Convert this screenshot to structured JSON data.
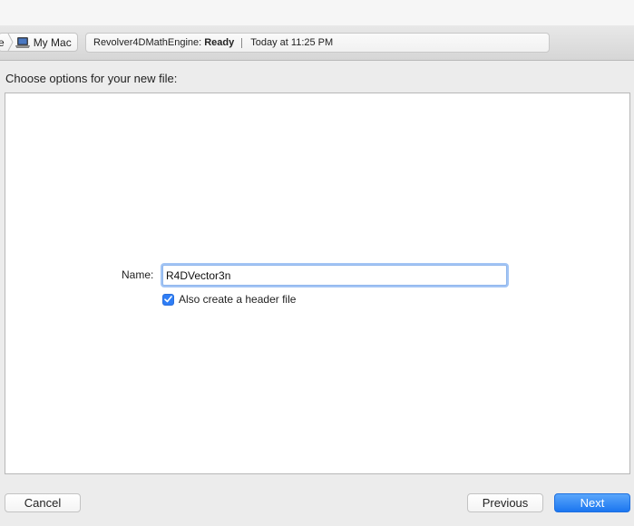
{
  "toolbar": {
    "scheme_partial": "e",
    "destination": "My Mac",
    "activity": {
      "project": "Revolver4DMathEngine:",
      "status": "Ready",
      "timestamp": "Today at 11:25 PM"
    }
  },
  "dialog": {
    "prompt": "Choose options for your new file:",
    "name_label": "Name:",
    "name_value": "R4DVector3n",
    "header_checkbox_label": "Also create a header file",
    "header_checkbox_checked": true
  },
  "buttons": {
    "cancel": "Cancel",
    "previous": "Previous",
    "next": "Next"
  },
  "colors": {
    "accent": "#2f7ef6",
    "focus_ring": "#a3c5f5"
  },
  "icons": {
    "destination": "laptop-icon",
    "checkbox": "checkmark-icon",
    "separator": "chevron-right-icon"
  }
}
